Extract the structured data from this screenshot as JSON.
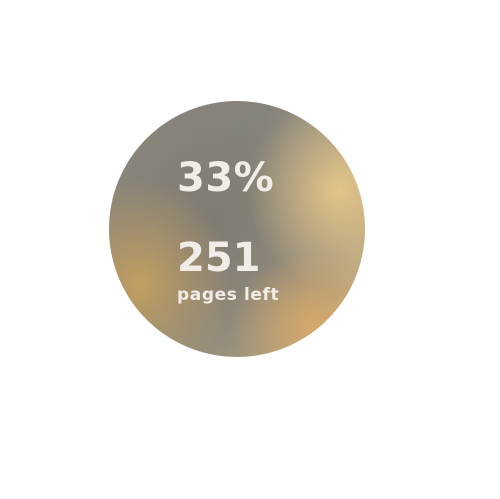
{
  "progress_widget": {
    "percent_text": "33%",
    "percent_value": 33,
    "pages_left_count": "251",
    "pages_left_label": "pages left",
    "colors": {
      "gold": "#d6a868",
      "gray": "#807c72",
      "text": "#f1ede6"
    }
  }
}
